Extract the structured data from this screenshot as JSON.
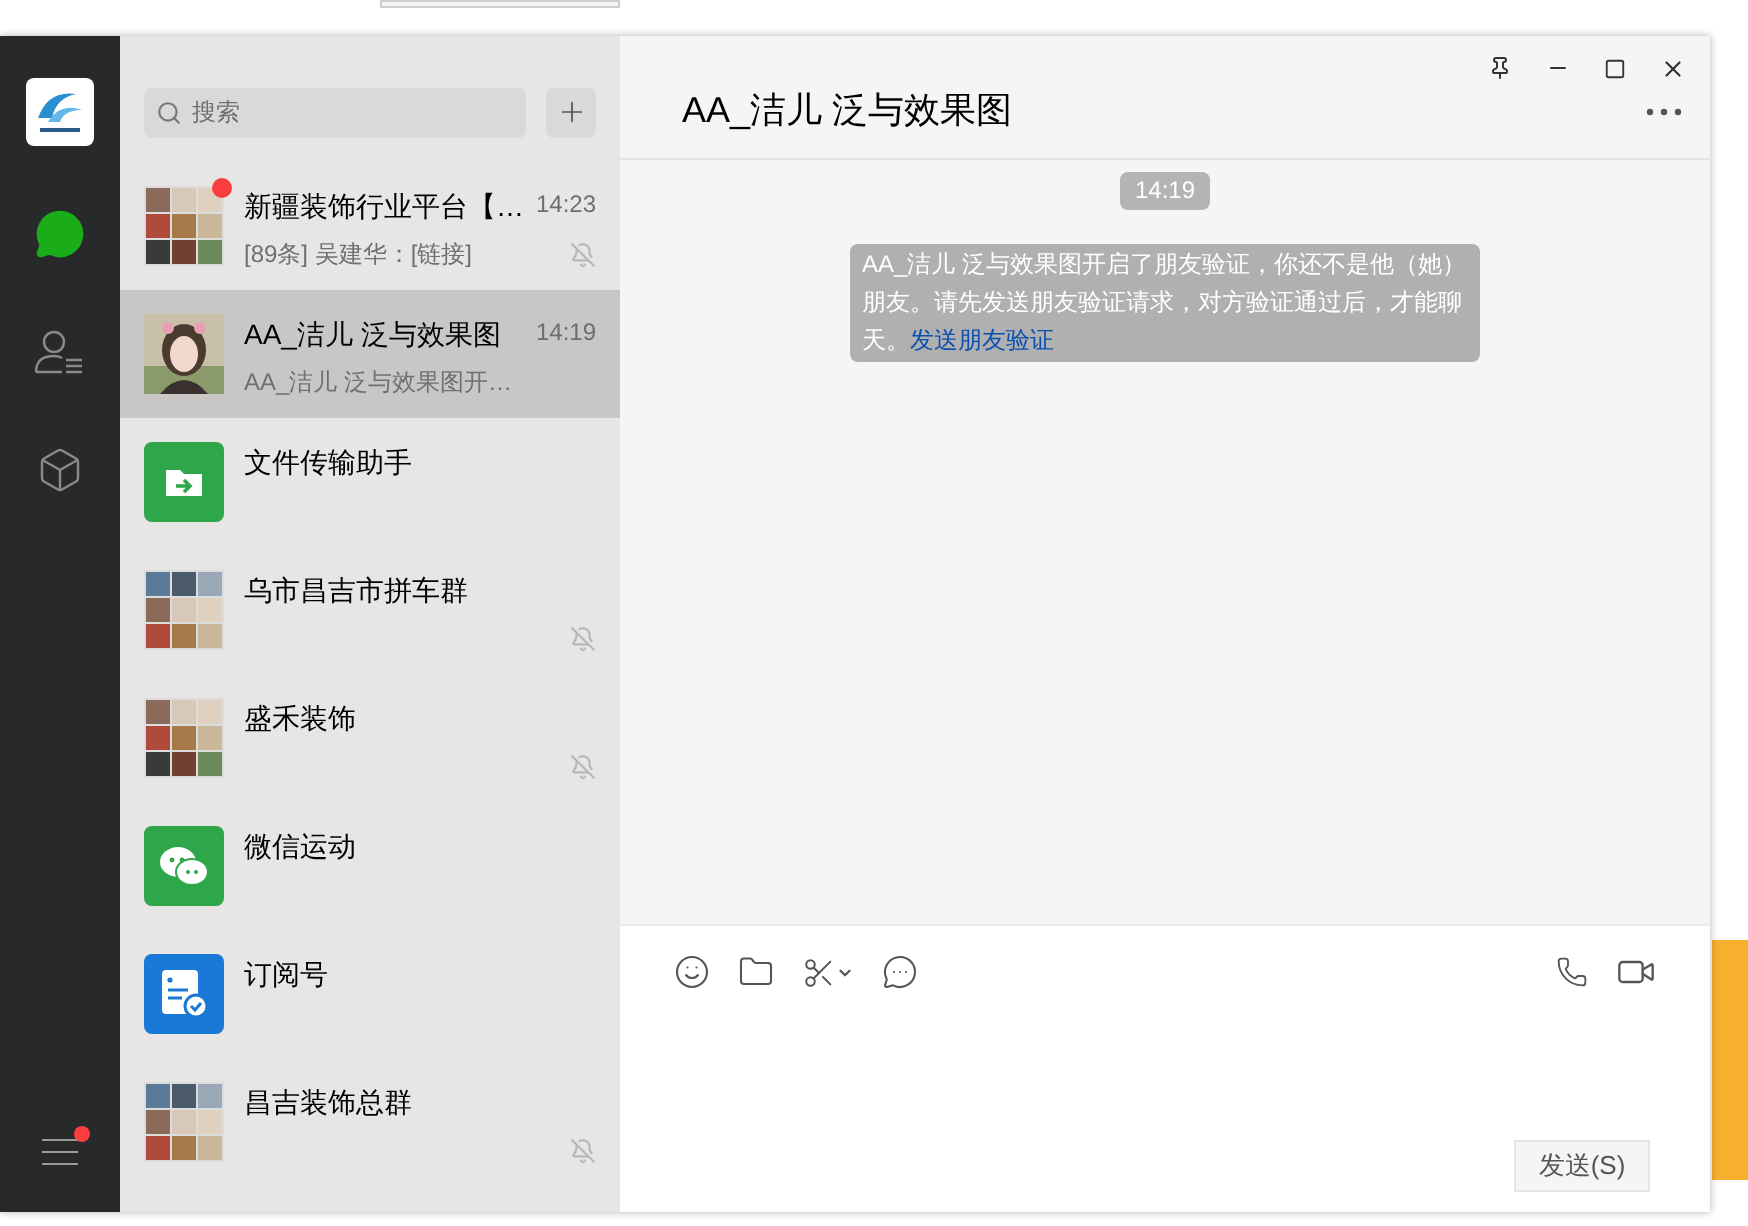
{
  "nav": {
    "items": [
      {
        "kind": "chats",
        "selected": true
      },
      {
        "kind": "contacts",
        "selected": false
      },
      {
        "kind": "favorites",
        "selected": false
      }
    ],
    "menu_badge": true
  },
  "search": {
    "placeholder": "搜索"
  },
  "chats": [
    {
      "kind": "group",
      "name": "新疆装饰行业平台【…",
      "time": "14:23",
      "preview": "[89条] 吴建华：[链接]",
      "muted": true,
      "unread": true,
      "selected": false
    },
    {
      "name": "AA_洁儿 泛与效果图",
      "time": "14:19",
      "preview": "AA_洁儿 泛与效果图开…",
      "muted": false,
      "unread": false,
      "selected": true
    },
    {
      "kind": "file-transfer",
      "name": "文件传输助手",
      "muted": false,
      "unread": false,
      "selected": false
    },
    {
      "kind": "group",
      "name": "乌市昌吉市拼车群",
      "muted": true,
      "unread": false,
      "selected": false
    },
    {
      "kind": "group",
      "name": "盛禾装饰",
      "muted": true,
      "unread": false,
      "selected": false
    },
    {
      "kind": "sport",
      "name": "微信运动",
      "muted": false,
      "unread": false,
      "selected": false
    },
    {
      "kind": "subscription",
      "name": "订阅号",
      "muted": false,
      "unread": false,
      "selected": false
    },
    {
      "kind": "group",
      "name": "昌吉装饰总群",
      "muted": true,
      "unread": false,
      "selected": false
    }
  ],
  "window": {
    "title": "AA_洁儿 泛与效果图"
  },
  "messages": [
    {
      "kind": "time",
      "text": "14:19"
    },
    {
      "kind": "system",
      "text": "AA_洁儿 泛与效果图开启了朋友验证，你还不是他（她）朋友。请先发送朋友验证请求，对方验证通过后，才能聊天。",
      "link": "发送朋友验证"
    }
  ],
  "send_button": "发送(S)"
}
